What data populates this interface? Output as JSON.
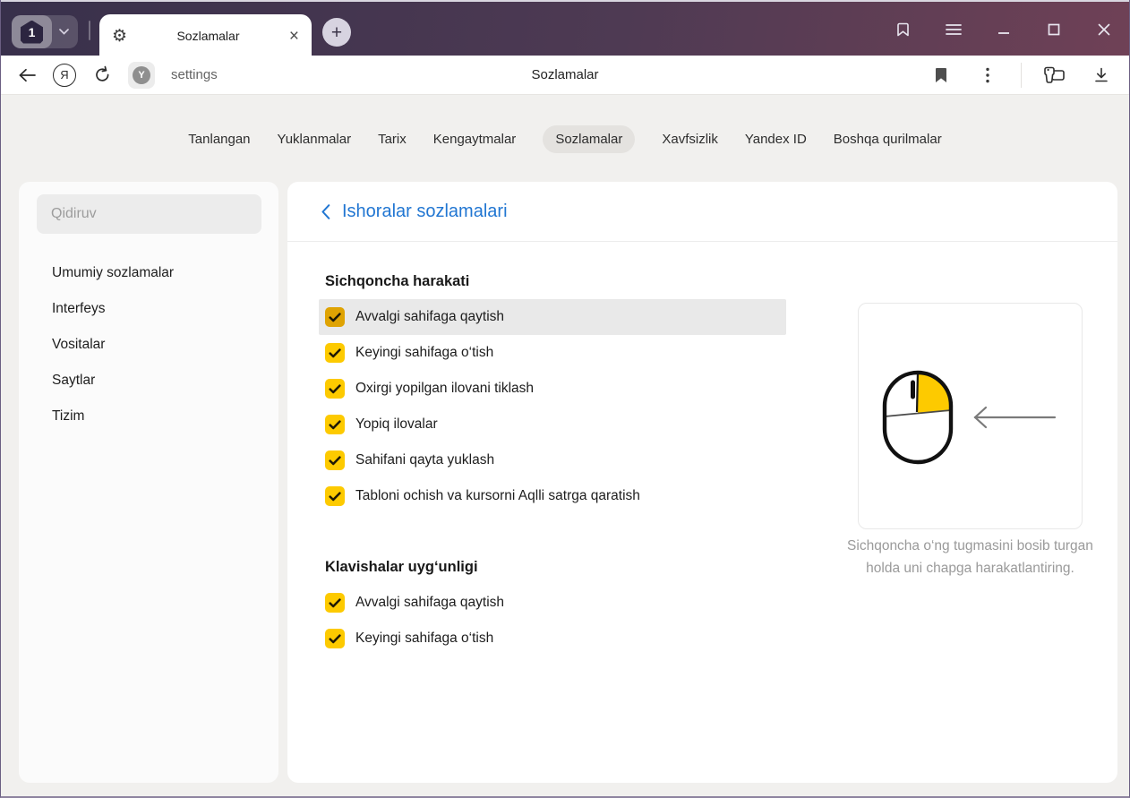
{
  "titlebar": {
    "tab_count": "1",
    "tab_title": "Sozlamalar",
    "new_tab_glyph": "+",
    "close_tab_glyph": "×"
  },
  "toolbar": {
    "address": "settings",
    "page_title": "Sozlamalar",
    "yandex_letter": "Я",
    "protect_letter": "Y"
  },
  "nav": {
    "tabs": [
      "Tanlangan",
      "Yuklanmalar",
      "Tarix",
      "Kengaytmalar",
      "Sozlamalar",
      "Xavfsizlik",
      "Yandex ID",
      "Boshqa qurilmalar"
    ],
    "active": "Sozlamalar"
  },
  "sidebar": {
    "search_placeholder": "Qidiruv",
    "items": [
      "Umumiy sozlamalar",
      "Interfeys",
      "Vositalar",
      "Saytlar",
      "Tizim"
    ]
  },
  "main": {
    "back_header": "Ishoralar sozlamalari",
    "sections": [
      {
        "title": "Sichqoncha harakati",
        "items": [
          {
            "label": "Avvalgi sahifaga qaytish",
            "checked": true,
            "highlighted": true
          },
          {
            "label": "Keyingi sahifaga o‘tish",
            "checked": true,
            "highlighted": false
          },
          {
            "label": "Oxirgi yopilgan ilovani tiklash",
            "checked": true,
            "highlighted": false
          },
          {
            "label": "Yopiq ilovalar",
            "checked": true,
            "highlighted": false
          },
          {
            "label": "Sahifani qayta yuklash",
            "checked": true,
            "highlighted": false
          },
          {
            "label": "Tabloni ochish va kursorni Aqlli satrga qaratish",
            "checked": true,
            "highlighted": false
          }
        ]
      },
      {
        "title": "Klavishalar uyg‘unligi",
        "items": [
          {
            "label": "Avvalgi sahifaga qaytish",
            "checked": true,
            "highlighted": false
          },
          {
            "label": "Keyingi sahifaga o‘tish",
            "checked": true,
            "highlighted": false
          }
        ]
      }
    ],
    "illustration": {
      "caption": "Sichqoncha o‘ng tugmasini bosib turgan holda uni chapga harakatlantiring.",
      "subject": "mouse-right-button-drag-left"
    }
  },
  "colors": {
    "accent_yellow": "#fdca00",
    "accent_yellow_active": "#dfa303",
    "link_blue": "#2176d2",
    "row_highlight": "#e9e9e9",
    "titlebar_gradient_start": "#38304b",
    "titlebar_gradient_end": "#6f4156"
  }
}
